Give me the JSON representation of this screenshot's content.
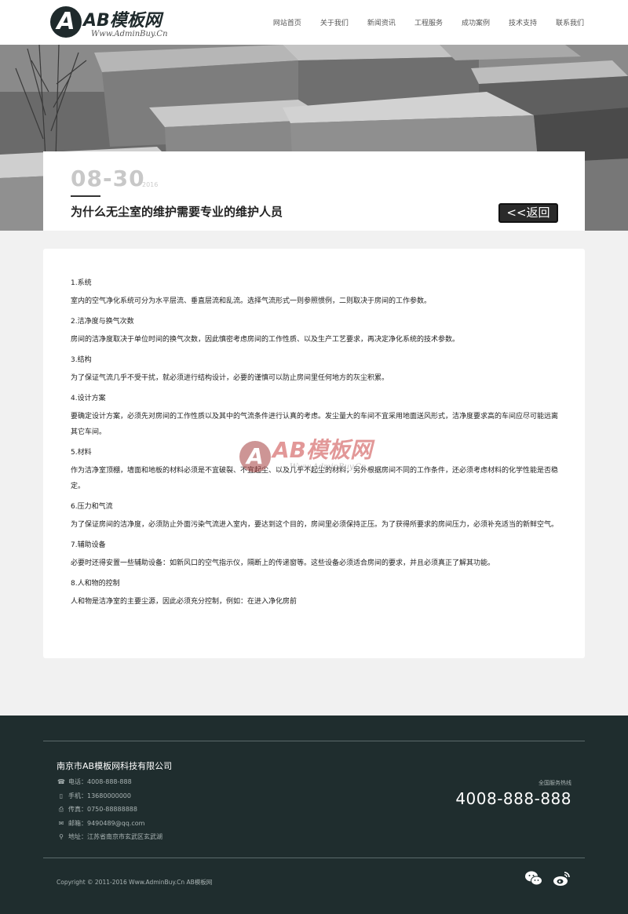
{
  "header": {
    "logo_badge": "A",
    "logo_text": "AB模板网",
    "logo_sub": "Www.AdminBuy.Cn",
    "nav": [
      "网站首页",
      "关于我们",
      "新闻资讯",
      "工程服务",
      "成功案例",
      "技术支持",
      "联系我们"
    ]
  },
  "article": {
    "date": "08-30",
    "year": "2016",
    "title": "为什么无尘室的维护需要专业的维护人员",
    "back_label": "<<返回",
    "sections": [
      {
        "title": "1.系统",
        "body": "室内的空气净化系统可分为水平层流、垂直层流和乱流。选择气流形式一则参照惯例，二则取决于房间的工作参数。"
      },
      {
        "title": "2.洁净度与换气次数",
        "body": "房间的洁净度取决于单位时间的换气次数，因此慎密考虑房间的工作性质、以及生产工艺要求，再决定净化系统的技术参数。"
      },
      {
        "title": "3.结构",
        "body": "为了保证气流几乎不受干扰，就必须进行结构设计，必要的谨慎可以防止房间里任何地方的灰尘积累。"
      },
      {
        "title": "4.设计方案",
        "body": "要确定设计方案，必须先对房间的工作性质以及其中的气流条件进行认真的考虑。发尘量大的车间不宜采用地面送风形式，洁净度要求高的车间应尽可能远离其它车间。"
      },
      {
        "title": "5.材料",
        "body": "作为洁净室顶棚，墙面和地板的材料必须是不宜破裂、不宜起尘、以及几乎不起尘的材料，另外根据房间不同的工作条件，还必须考虑材料的化学性能是否稳定。"
      },
      {
        "title": "6.压力和气流",
        "body": "为了保证房间的洁净度，必须防止外面污染气流进入室内，要达到这个目的，房间里必须保持正压。为了获得所要求的房间压力，必须补充适当的新鲜空气。"
      },
      {
        "title": "7.辅助设备",
        "body": "必要时还得安置一些辅助设备：如新风口的空气指示仪，隔断上的传递窗等。这些设备必须适合房间的要求，并且必须真正了解其功能。"
      },
      {
        "title": "8.人和物的控制",
        "body": "人和物是洁净室的主要尘源，因此必须充分控制，例如：在进入净化房前"
      }
    ],
    "watermark_text": "AB模板网",
    "watermark_sub": "Www.AdminBuy.Cn"
  },
  "footer": {
    "company": "南京市AB模板网科技有限公司",
    "info": [
      {
        "icon": "phone-icon",
        "glyph": "☎",
        "text": "电话：4008-888-888"
      },
      {
        "icon": "mobile-icon",
        "glyph": "▯",
        "text": "手机：13680000000"
      },
      {
        "icon": "fax-icon",
        "glyph": "⎙",
        "text": "传真：0750-88888888"
      },
      {
        "icon": "mail-icon",
        "glyph": "✉",
        "text": "邮箱：9490489@qq.com"
      },
      {
        "icon": "location-icon",
        "glyph": "⚲",
        "text": "地址：江苏省南京市玄武区玄武湖"
      }
    ],
    "hotline_label": "全国服务热线",
    "hotline": "4008-888-888",
    "copyright": "Copyright © 2011-2016 Www.AdminBuy.Cn AB模板网",
    "social": [
      "wechat-icon",
      "weibo-icon"
    ]
  }
}
